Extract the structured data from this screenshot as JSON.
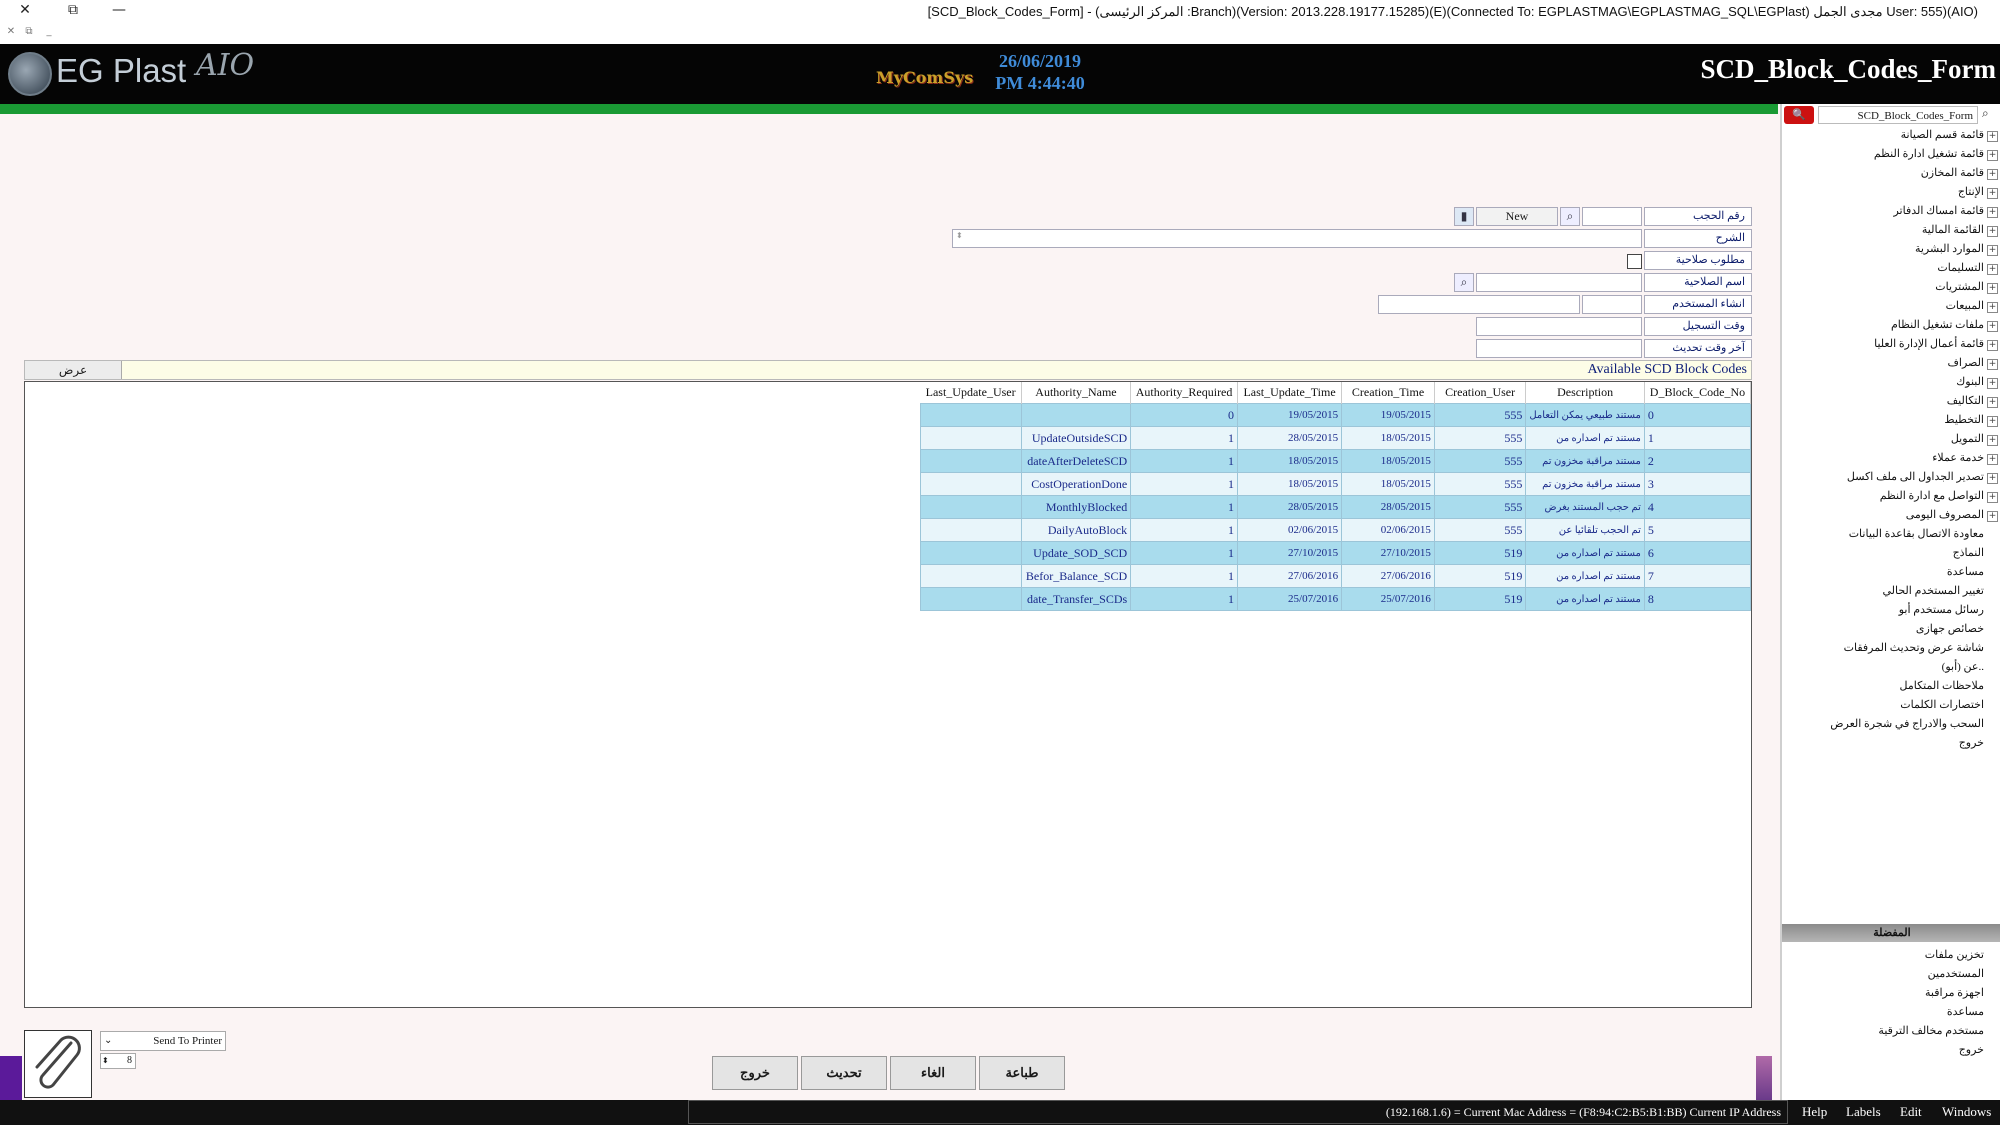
{
  "window": {
    "title": "[SCD_Block_Codes_Form] - (المركز الرئيسى :Branch)(Version: 2013.228.19177.15285)(E)(Connected To: EGPLASTMAG\\EGPLASTMAG_SQL\\EGPlast) مجدى الجمل User: 555)(AIO)",
    "close_glyph": "✕",
    "restore_glyph": "⧉",
    "minimize_glyph": "—"
  },
  "header": {
    "logo_text": "EG Plast",
    "logo_suffix": "AIO",
    "mid_logo": "MyComSys",
    "date": "26/06/2019",
    "time": "PM 4:44:40",
    "form_title": "SCD_Block_Codes_Form"
  },
  "nav": {
    "search_value": "SCD_Block_Codes_Form",
    "items": [
      {
        "label": "قائمة قسم الصيانة",
        "expand": true
      },
      {
        "label": "قائمة تشغيل ادارة النظم",
        "expand": true
      },
      {
        "label": "قائمة المخازن",
        "expand": true
      },
      {
        "label": "الإنتاج",
        "expand": true
      },
      {
        "label": "قائمة امساك الدفاتر",
        "expand": true
      },
      {
        "label": "القائمة المالية",
        "expand": true
      },
      {
        "label": "الموارد البشرية",
        "expand": true
      },
      {
        "label": "التسليمات",
        "expand": true
      },
      {
        "label": "المشتريات",
        "expand": true
      },
      {
        "label": "المبيعات",
        "expand": true
      },
      {
        "label": "ملفات تشغيل النظام",
        "expand": true
      },
      {
        "label": "قائمة أعمال الإدارة العليا",
        "expand": true
      },
      {
        "label": "الصراف",
        "expand": true
      },
      {
        "label": "البنوك",
        "expand": true
      },
      {
        "label": "التكاليف",
        "expand": true
      },
      {
        "label": "التخطيط",
        "expand": true
      },
      {
        "label": "التمويل",
        "expand": true
      },
      {
        "label": "خدمة عملاء",
        "expand": true
      },
      {
        "label": "تصدير الجداول الى ملف اكسل",
        "expand": true
      },
      {
        "label": "التواصل مع ادارة النظم",
        "expand": true
      },
      {
        "label": "المصروف اليومى",
        "expand": true
      },
      {
        "label": "معاودة الاتصال بقاعدة البيانات",
        "expand": false
      },
      {
        "label": "النماذج",
        "expand": false
      },
      {
        "label": "مساعدة",
        "expand": false
      },
      {
        "label": "تغيير المستخدم الحالي",
        "expand": false
      },
      {
        "label": "رسائل مستخدم أبو",
        "expand": false
      },
      {
        "label": "خصائص جهازى",
        "expand": false
      },
      {
        "label": "شاشة عرض وتحديث المرفقات",
        "expand": false
      },
      {
        "label": "عن (أبو)..",
        "expand": false
      },
      {
        "label": "ملاحظات المتكامل",
        "expand": false
      },
      {
        "label": "اختصارات الكلمات",
        "expand": false
      },
      {
        "label": "السحب والادراج في شجرة العرض",
        "expand": false
      },
      {
        "label": "خروج",
        "expand": false
      }
    ],
    "favorites_title": "المفضلة",
    "favorites": [
      "تخزين ملفات",
      "المستخدمين",
      "اجهزة مراقبة",
      "مساعدة",
      "مستخدم مخالف الترقية",
      "خروج"
    ]
  },
  "form": {
    "block_no_label": "رقم الحجب",
    "block_no_value": "",
    "new_button": "New",
    "description_label": "الشرح",
    "authority_required_label": "مطلوب صلاحية",
    "authority_name_label": "اسم الصلاحية",
    "created_by_label": "انشاء المستخدم",
    "creation_time_label": "وقت التسجيل",
    "last_update_label": "آخر وقت تحديث",
    "section_title": "Available SCD Block Codes",
    "show_button": "عرض"
  },
  "grid": {
    "columns": [
      "Last_Update_User",
      "Authority_Name",
      "Authority_Required",
      "Last_Update_Time",
      "Creation_Time",
      "Creation_User",
      "Description",
      "D_Block_Code_No"
    ],
    "rows": [
      {
        "last_update_user": "",
        "authority_name": "",
        "authority_required": "0",
        "last_update_time": "19/05/2015",
        "creation_time": "19/05/2015",
        "creation_user": "555",
        "description": "مستند طبيعي يمكن التعامل",
        "code": "0"
      },
      {
        "last_update_user": "",
        "authority_name": "UpdateOutsideSCD",
        "authority_required": "1",
        "last_update_time": "28/05/2015",
        "creation_time": "18/05/2015",
        "creation_user": "555",
        "description": "مستند تم اصداره من",
        "code": "1"
      },
      {
        "last_update_user": "",
        "authority_name": "dateAfterDeleteSCD",
        "authority_required": "1",
        "last_update_time": "18/05/2015",
        "creation_time": "18/05/2015",
        "creation_user": "555",
        "description": "مستند مراقبة مخزون تم",
        "code": "2"
      },
      {
        "last_update_user": "",
        "authority_name": "CostOperationDone",
        "authority_required": "1",
        "last_update_time": "18/05/2015",
        "creation_time": "18/05/2015",
        "creation_user": "555",
        "description": "مستند مراقبة مخزون تم",
        "code": "3"
      },
      {
        "last_update_user": "",
        "authority_name": "MonthlyBlocked",
        "authority_required": "1",
        "last_update_time": "28/05/2015",
        "creation_time": "28/05/2015",
        "creation_user": "555",
        "description": "تم حجب المستند بغرض",
        "code": "4"
      },
      {
        "last_update_user": "",
        "authority_name": "DailyAutoBlock",
        "authority_required": "1",
        "last_update_time": "02/06/2015",
        "creation_time": "02/06/2015",
        "creation_user": "555",
        "description": "تم الحجب تلقائيا عن",
        "code": "5"
      },
      {
        "last_update_user": "",
        "authority_name": "Update_SOD_SCD",
        "authority_required": "1",
        "last_update_time": "27/10/2015",
        "creation_time": "27/10/2015",
        "creation_user": "519",
        "description": "مستند تم اصداره من",
        "code": "6"
      },
      {
        "last_update_user": "",
        "authority_name": "Befor_Balance_SCD",
        "authority_required": "1",
        "last_update_time": "27/06/2016",
        "creation_time": "27/06/2016",
        "creation_user": "519",
        "description": "مستند تم اصداره من",
        "code": "7"
      },
      {
        "last_update_user": "",
        "authority_name": "date_Transfer_SCDs",
        "authority_required": "1",
        "last_update_time": "25/07/2016",
        "creation_time": "25/07/2016",
        "creation_user": "519",
        "description": "مستند تم اصداره من",
        "code": "8"
      }
    ]
  },
  "bottom": {
    "send_to_printer": "Send To Printer",
    "copies": "8",
    "buttons": {
      "exit": "خروج",
      "update": "تحديث",
      "cancel": "الغاء",
      "print": "طباعة"
    }
  },
  "status": {
    "ip_text": "(192.168.1.6) = Current Mac Address = (F8:94:C2:B5:B1:BB) Current IP Address",
    "menus": [
      "Help",
      "Labels",
      "Edit",
      "Windows"
    ]
  },
  "colors": {
    "header_bg": "#050505",
    "green_bar": "#1a9a34",
    "date_blue": "#3f8bd8",
    "row_blue": "#a9dced",
    "row_light": "#e8f5fa",
    "search_red": "#cc1111"
  }
}
